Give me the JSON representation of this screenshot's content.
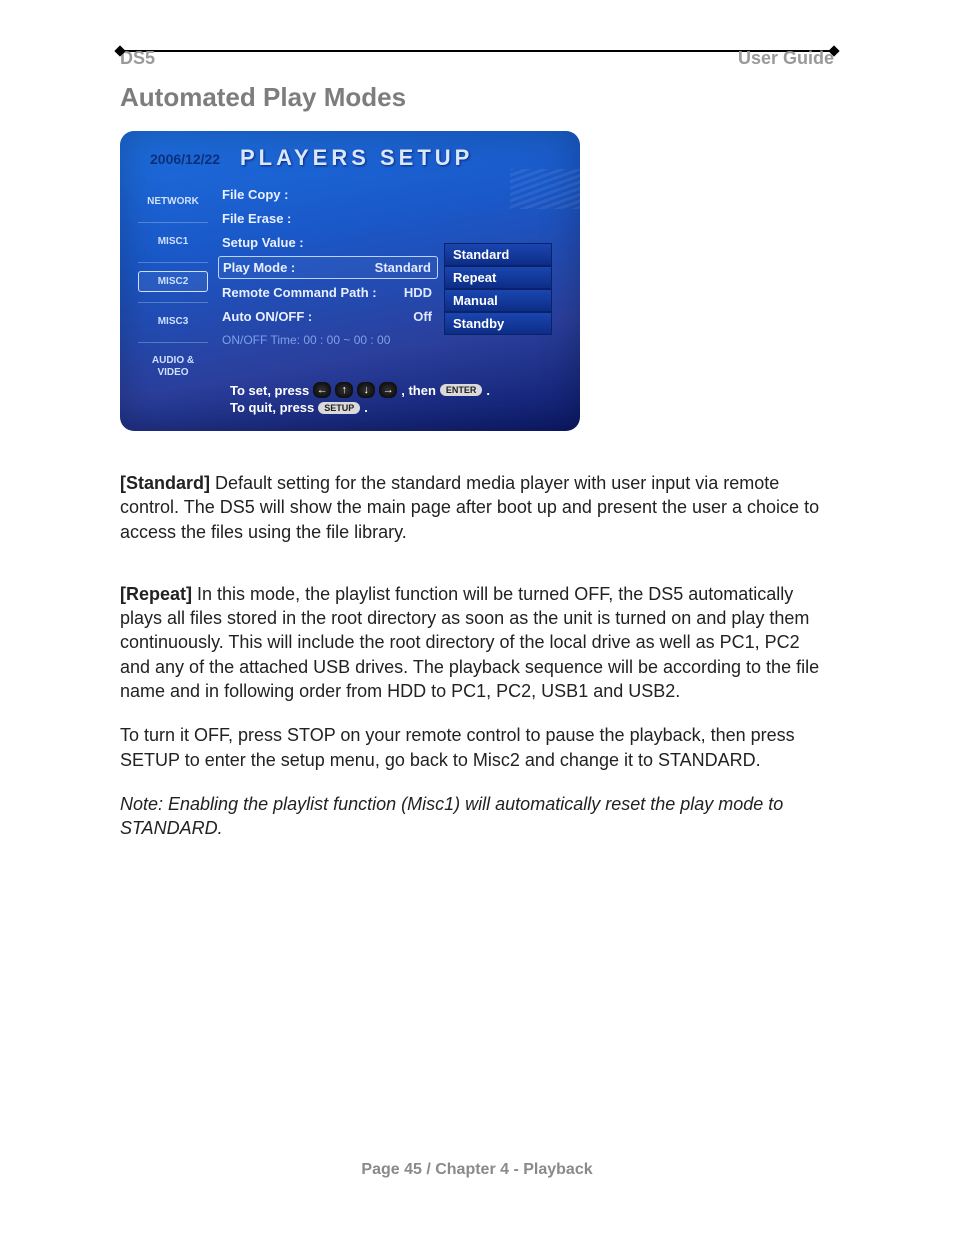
{
  "header": {
    "left": "DS5",
    "right": "User Guide"
  },
  "section_title": "Automated Play Modes",
  "screenshot": {
    "date": "2006/12/22",
    "title": "PLAYERS SETUP",
    "sidebar": [
      "NETWORK",
      "MISC1",
      "MISC2",
      "MISC3",
      "AUDIO & VIDEO"
    ],
    "selected_sidebar_index": 2,
    "rows": [
      {
        "label": "File Copy :",
        "value": ""
      },
      {
        "label": "File Erase :",
        "value": ""
      },
      {
        "label": "Setup Value :",
        "value": ""
      },
      {
        "label": "Play Mode :",
        "value": "Standard",
        "boxed": true
      },
      {
        "label": "Remote Command Path :",
        "value": "HDD"
      },
      {
        "label": "Auto ON/OFF :",
        "value": "Off"
      },
      {
        "label": "ON/OFF Time: 00 : 00 ~ 00 : 00",
        "value": "",
        "dim": true
      }
    ],
    "dropdown": [
      "Standard",
      "Repeat",
      "Manual",
      "Standby"
    ],
    "hints": {
      "set_prefix": "To set, press",
      "set_then": ", then",
      "enter_label": "ENTER",
      "set_suffix": ".",
      "quit_prefix": "To quit, press",
      "setup_label": "SETUP",
      "quit_suffix": "."
    }
  },
  "paragraphs": {
    "standard_label": "[Standard]",
    "standard_text": " Default setting for the standard media player with user input via remote control. The DS5 will show the main page after boot up and present the user a choice to access the files using the file library.",
    "repeat_label": "[Repeat]",
    "repeat_text": " In this mode, the playlist function will be turned OFF, the DS5 automatically plays all files stored in the root directory as soon as the unit is turned on and play them continuously. This will include the root directory of the local drive as well as PC1, PC2 and any of the attached USB drives. The playback sequence will be according to the file name and in following order from HDD to PC1, PC2, USB1 and USB2.",
    "turnoff_text": "To turn it OFF, press STOP on your remote control to pause the playback, then press SETUP to enter the setup menu, go back to Misc2 and change it to STANDARD.",
    "note_text": "Note: Enabling the playlist function (Misc1) will automatically reset the play mode to STANDARD."
  },
  "footer": "Page 45  /  Chapter 4 - Playback"
}
